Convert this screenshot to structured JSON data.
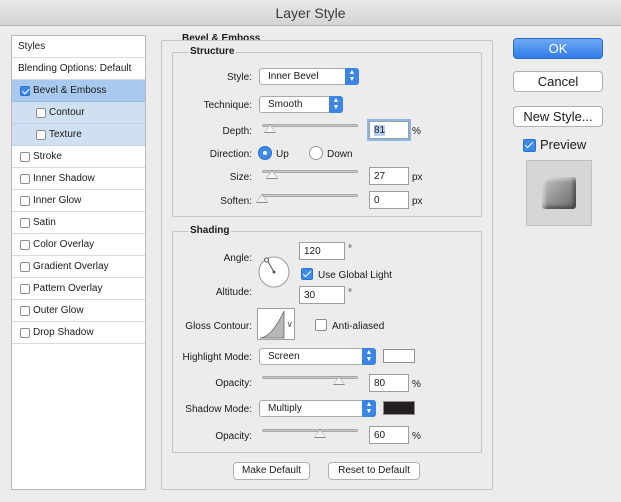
{
  "window": {
    "title": "Layer Style"
  },
  "styles_list": {
    "header": "Styles",
    "blending": "Blending Options: Default",
    "items": [
      {
        "label": "Bevel & Emboss",
        "checked": true,
        "selected": true
      },
      {
        "label": "Contour",
        "checked": false,
        "sub": true
      },
      {
        "label": "Texture",
        "checked": false,
        "sub": true
      },
      {
        "label": "Stroke",
        "checked": false
      },
      {
        "label": "Inner Shadow",
        "checked": false
      },
      {
        "label": "Inner Glow",
        "checked": false
      },
      {
        "label": "Satin",
        "checked": false
      },
      {
        "label": "Color Overlay",
        "checked": false
      },
      {
        "label": "Gradient Overlay",
        "checked": false
      },
      {
        "label": "Pattern Overlay",
        "checked": false
      },
      {
        "label": "Outer Glow",
        "checked": false
      },
      {
        "label": "Drop Shadow",
        "checked": false
      }
    ]
  },
  "bevel": {
    "title": "Bevel & Emboss",
    "structure": {
      "legend": "Structure",
      "style_label": "Style:",
      "style_value": "Inner Bevel",
      "technique_label": "Technique:",
      "technique_value": "Smooth",
      "depth_label": "Depth:",
      "depth_value": "81",
      "depth_fraction": 0.081,
      "depth_unit": "%",
      "direction_label": "Direction:",
      "direction_up": "Up",
      "direction_down": "Down",
      "size_label": "Size:",
      "size_value": "27",
      "size_fraction": 0.108,
      "size_unit": "px",
      "soften_label": "Soften:",
      "soften_value": "0",
      "soften_fraction": 0.0,
      "soften_unit": "px"
    },
    "shading": {
      "legend": "Shading",
      "angle_label": "Angle:",
      "angle_value": "120",
      "angle_unit": "°",
      "global_light_label": "Use Global Light",
      "altitude_label": "Altitude:",
      "altitude_value": "30",
      "altitude_unit": "°",
      "gloss_label": "Gloss Contour:",
      "anti_aliased_label": "Anti-aliased",
      "highlight_mode_label": "Highlight Mode:",
      "highlight_mode_value": "Screen",
      "highlight_color": "#ffffff",
      "highlight_opacity_label": "Opacity:",
      "highlight_opacity_value": "80",
      "highlight_opacity_fraction": 0.8,
      "highlight_opacity_unit": "%",
      "shadow_mode_label": "Shadow Mode:",
      "shadow_mode_value": "Multiply",
      "shadow_color": "#231f20",
      "shadow_opacity_label": "Opacity:",
      "shadow_opacity_value": "60",
      "shadow_opacity_fraction": 0.6,
      "shadow_opacity_unit": "%"
    },
    "make_default": "Make Default",
    "reset_default": "Reset to Default"
  },
  "actions": {
    "ok": "OK",
    "cancel": "Cancel",
    "new_style": "New Style...",
    "preview": "Preview"
  },
  "colors": {
    "accent": "#3d8ae8",
    "selection": "#a9c9ee"
  }
}
